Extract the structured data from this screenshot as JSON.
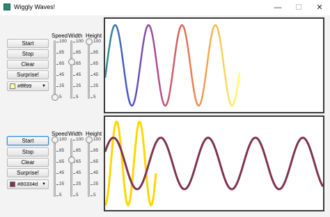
{
  "window": {
    "title": "Wiggly Waves!",
    "minimize": "—",
    "maximize": "☐",
    "close": "✕"
  },
  "panels": [
    {
      "buttons": [
        "Start",
        "Stop",
        "Clear",
        "Surprise!"
      ],
      "color_label": "#ffff99",
      "color_swatch": "#ffff99",
      "slider_labels": [
        "Speed",
        "Width",
        "Height"
      ],
      "tick_labels": [
        "100",
        "85",
        "65",
        "45",
        "25",
        "5"
      ],
      "slider_values": [
        5,
        65,
        100
      ]
    },
    {
      "buttons": [
        "Start",
        "Stop",
        "Clear",
        "Surprise!"
      ],
      "color_label": "#80334d",
      "color_swatch": "#80334d",
      "slider_labels": [
        "Speed",
        "Width",
        "Height"
      ],
      "tick_labels": [
        "100",
        "85",
        "65",
        "45",
        "25",
        "5"
      ],
      "slider_values": [
        100,
        65,
        100
      ]
    }
  ],
  "colors": {
    "wave_dark": "#80334d",
    "wave_yellow": "#ffd700"
  }
}
